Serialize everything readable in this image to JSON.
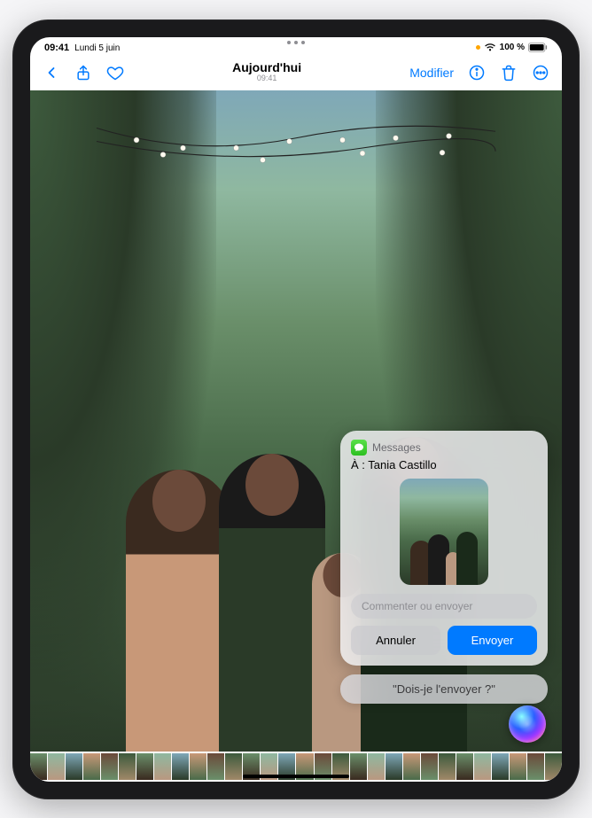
{
  "status": {
    "time": "09:41",
    "date": "Lundi 5 juin",
    "battery_text": "100 %"
  },
  "toolbar": {
    "title": "Aujourd'hui",
    "subtitle": "09:41",
    "modify_label": "Modifier"
  },
  "siri": {
    "app_name": "Messages",
    "recipient_prefix": "À :",
    "recipient_name": "Tania Castillo",
    "comment_placeholder": "Commenter ou envoyer",
    "cancel_label": "Annuler",
    "send_label": "Envoyer",
    "user_query": "\"Dois-je l'envoyer ?\""
  },
  "colors": {
    "accent": "#007aff",
    "messages_green": "#2bc020"
  }
}
